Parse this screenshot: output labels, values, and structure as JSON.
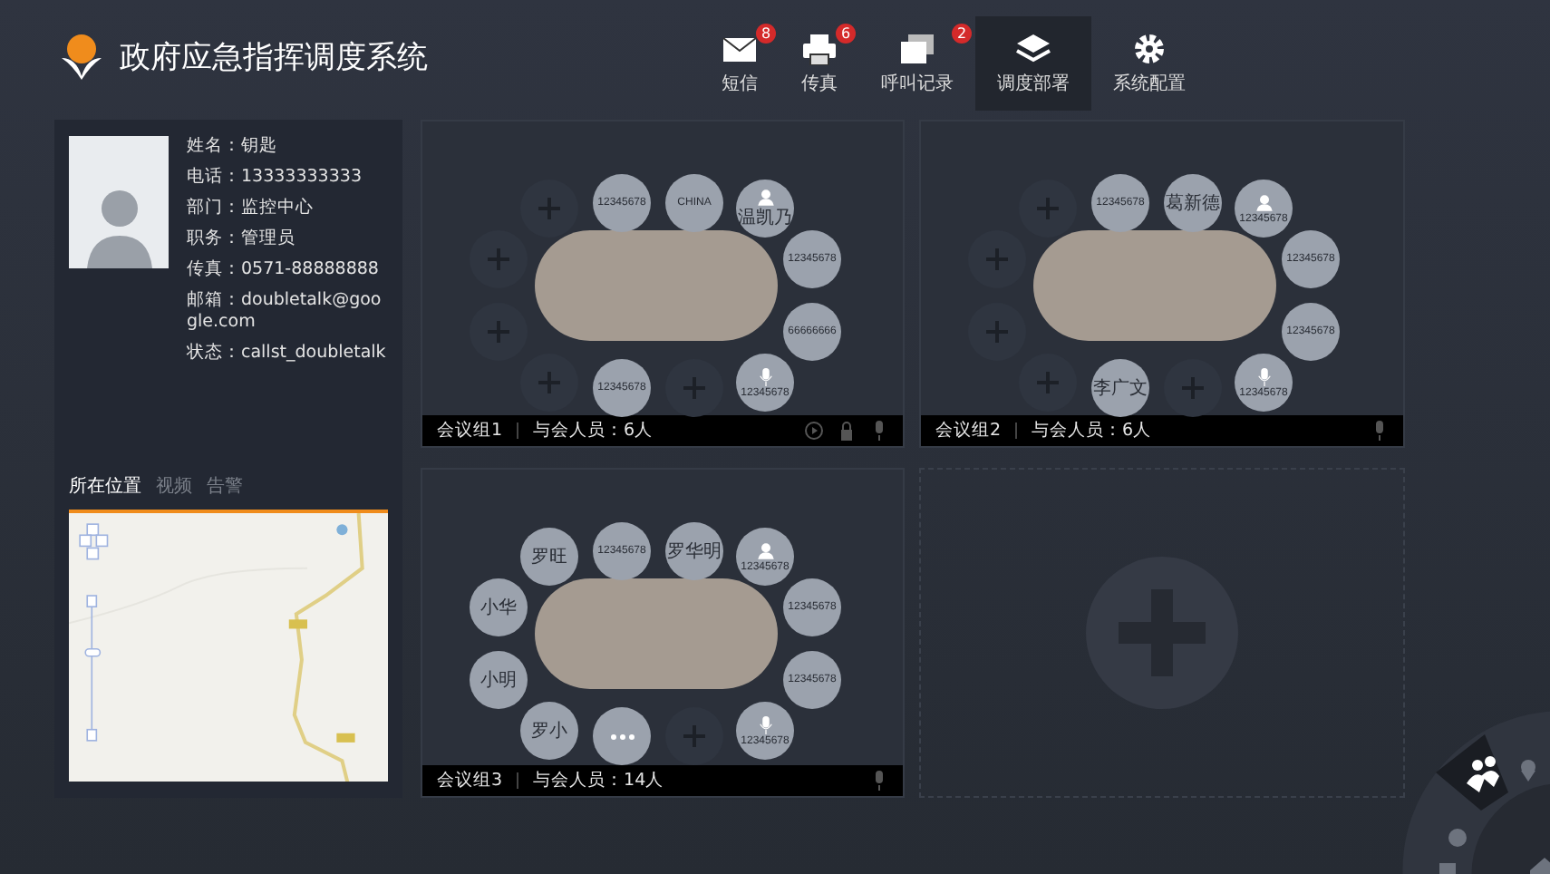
{
  "header": {
    "title": "政府应急指挥调度系统",
    "nav": [
      {
        "kind": "mail",
        "label": "短信",
        "badge": "8",
        "selected": false
      },
      {
        "kind": "fax",
        "label": "传真",
        "badge": "6",
        "selected": false
      },
      {
        "kind": "calls",
        "label": "呼叫记录",
        "badge": "2",
        "selected": false
      },
      {
        "kind": "layers",
        "label": "调度部署",
        "selected": true
      },
      {
        "kind": "gear",
        "label": "系统配置",
        "selected": false
      }
    ]
  },
  "profile": {
    "fields": [
      "姓名：钥匙",
      "电话：13333333333",
      "部门：监控中心",
      "职务：管理员",
      "传真：0571-88888888",
      "邮箱：doubletalk@google.com",
      "状态：callst_doubletalk"
    ]
  },
  "tabs": [
    {
      "label": "所在位置",
      "selected": true
    },
    {
      "label": "视频",
      "selected": false
    },
    {
      "label": "告警",
      "selected": false
    }
  ],
  "cards": [
    {
      "kind": "meeting",
      "name": "会议组1",
      "count": "与会人员：6人",
      "controls": [
        {
          "kind": "play"
        },
        {
          "kind": "lock"
        },
        {
          "kind": "mic"
        }
      ],
      "seats": [
        {
          "kind": "empty"
        },
        {
          "kind": "person",
          "label": "12345678"
        },
        {
          "kind": "person",
          "label": "CHINA"
        },
        {
          "kind": "host",
          "label": "温凯乃"
        },
        {
          "kind": "person",
          "label": "12345678"
        },
        {
          "kind": "person",
          "label": "66666666"
        },
        {
          "kind": "speaker",
          "label": "12345678"
        },
        {
          "kind": "empty"
        },
        {
          "kind": "person",
          "label": "12345678"
        },
        {
          "kind": "empty"
        },
        {
          "kind": "empty"
        },
        {
          "kind": "empty"
        }
      ]
    },
    {
      "kind": "meeting",
      "name": "会议组2",
      "count": "与会人员：6人",
      "controls": [
        {
          "kind": "mic"
        }
      ],
      "seats": [
        {
          "kind": "empty"
        },
        {
          "kind": "person",
          "label": "12345678"
        },
        {
          "kind": "person",
          "label": "葛新德"
        },
        {
          "kind": "host",
          "label": "12345678"
        },
        {
          "kind": "person",
          "label": "12345678"
        },
        {
          "kind": "person",
          "label": "12345678"
        },
        {
          "kind": "speaker",
          "label": "12345678"
        },
        {
          "kind": "empty"
        },
        {
          "kind": "person",
          "label": "李广文"
        },
        {
          "kind": "empty"
        },
        {
          "kind": "empty"
        },
        {
          "kind": "empty"
        }
      ]
    },
    {
      "kind": "meeting",
      "name": "会议组3",
      "count": "与会人员：14人",
      "controls": [
        {
          "kind": "mic"
        }
      ],
      "seats": [
        {
          "kind": "person",
          "label": "罗旺"
        },
        {
          "kind": "person",
          "label": "12345678"
        },
        {
          "kind": "person",
          "label": "罗华明"
        },
        {
          "kind": "host",
          "label": "12345678"
        },
        {
          "kind": "person",
          "label": "12345678"
        },
        {
          "kind": "person",
          "label": "12345678"
        },
        {
          "kind": "speaker",
          "label": "12345678"
        },
        {
          "kind": "empty"
        },
        {
          "kind": "more"
        },
        {
          "kind": "person",
          "label": "罗小"
        },
        {
          "kind": "person",
          "label": "小明"
        },
        {
          "kind": "person",
          "label": "小华"
        }
      ]
    },
    {
      "kind": "add"
    }
  ]
}
